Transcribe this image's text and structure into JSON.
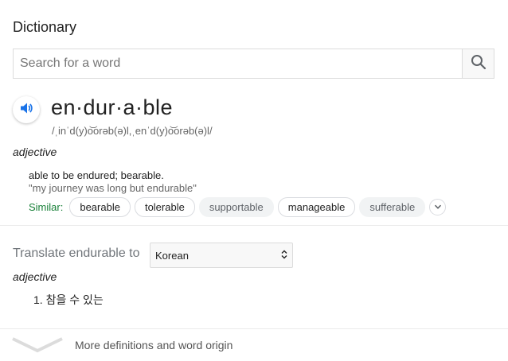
{
  "title": "Dictionary",
  "search": {
    "placeholder": "Search for a word"
  },
  "entry": {
    "headword": "en·dur·a·ble",
    "pronunciation": "/ˌinˈd(y)o͝orəb(ə)l,ˌenˈd(y)o͝orəb(ə)l/",
    "part_of_speech": "adjective",
    "definition": "able to be endured; bearable.",
    "example": "\"my journey was long but endurable\"",
    "similar_label": "Similar:",
    "similar": [
      {
        "word": "bearable",
        "style": "bordered"
      },
      {
        "word": "tolerable",
        "style": "bordered"
      },
      {
        "word": "supportable",
        "style": "plain"
      },
      {
        "word": "manageable",
        "style": "bordered"
      },
      {
        "word": "sufferable",
        "style": "plain"
      }
    ]
  },
  "translate": {
    "label": "Translate endurable to",
    "language": "Korean",
    "part_of_speech": "adjective",
    "items": [
      "1. 참을 수 있는"
    ]
  },
  "footer": {
    "more_label": "More definitions and word origin"
  },
  "colors": {
    "similar_label": "#188038",
    "speaker_icon": "#1a73e8",
    "divider": "#ebebeb"
  },
  "icons": {
    "search": "search-icon",
    "speaker": "speaker-icon",
    "expand": "chevron-down-icon",
    "more": "chevron-down-icon"
  }
}
